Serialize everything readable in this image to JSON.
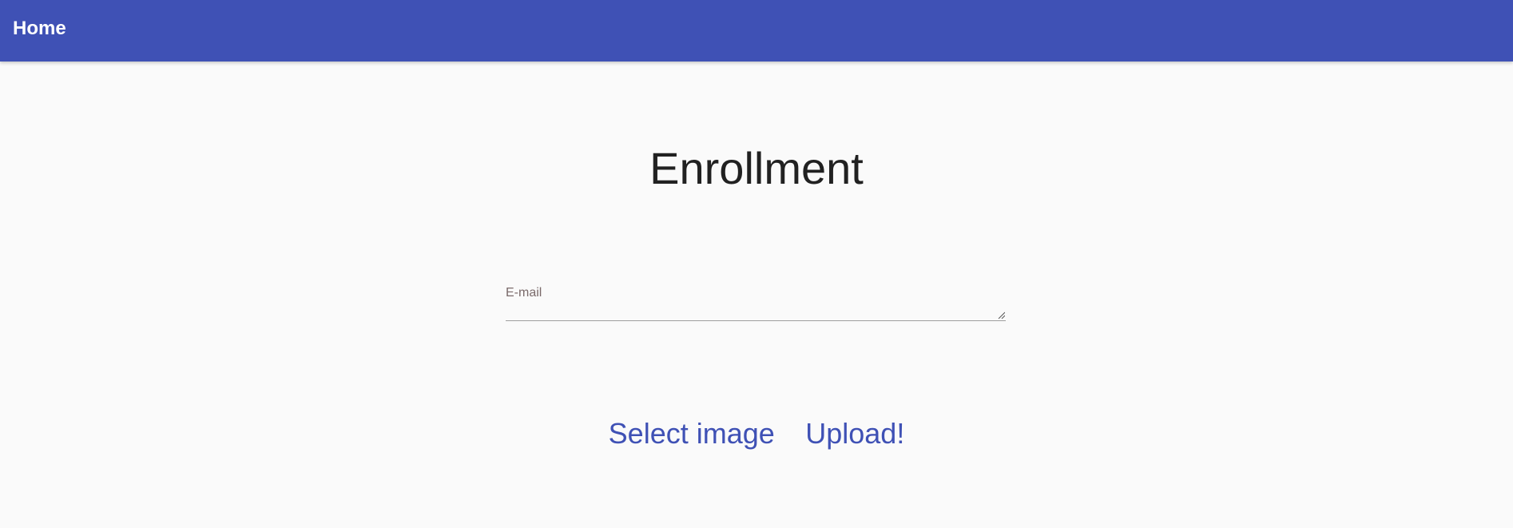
{
  "app_bar": {
    "title": "Home",
    "background_color": "#3f51b5"
  },
  "main": {
    "title": "Enrollment",
    "email_field": {
      "label": "E-mail",
      "value": ""
    },
    "actions": {
      "select_image_label": "Select image",
      "upload_label": "Upload!"
    },
    "accent_color": "#3f51b5"
  }
}
